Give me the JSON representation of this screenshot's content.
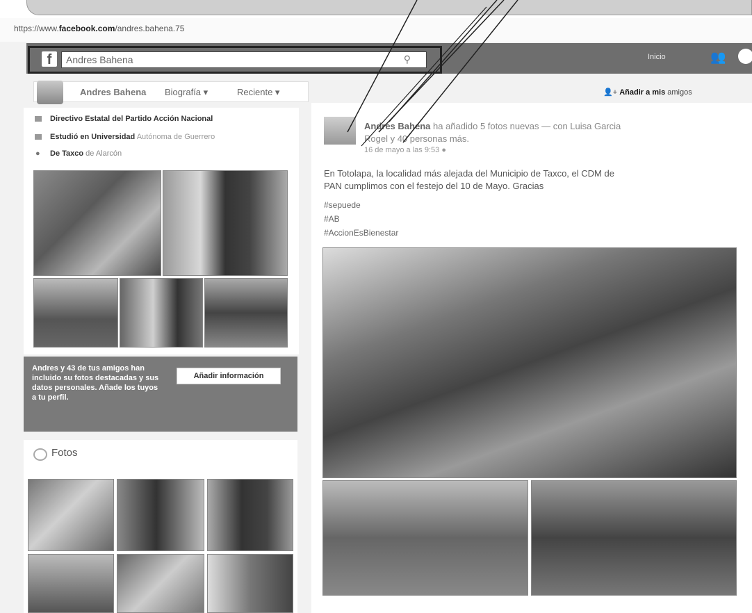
{
  "browser": {
    "url_prefix": "https://www.",
    "url_domain": "facebook.com",
    "url_path": "/andres.bahena.75"
  },
  "fb_bar": {
    "logo": "f",
    "search_value": "Andres Bahena",
    "inicio": "Inicio"
  },
  "profile_nav": {
    "name": "Andres Bahena",
    "biografia": "Biografía",
    "reciente": "Reciente"
  },
  "add_friends": {
    "bold": "Añadir a mis",
    "rest": "amigos"
  },
  "left_info": {
    "line1": "Directivo Estatal del Partido Acción Nacional",
    "line2_bold": "Estudió en Universidad",
    "line2_rest": "Autónoma de Guerrero",
    "line3_bold": "De Taxco",
    "line3_rest": "de Alarcón"
  },
  "promo": {
    "text": "Andres y 43 de tus amigos han incluido su fotos destacadas y sus datos personales. Añade los tuyos a tu perfil.",
    "button": "Añadir información"
  },
  "photos_section": {
    "title": "Fotos"
  },
  "post": {
    "author": "Andres Bahena",
    "action": "ha añadido 5 fotos nuevas — con Luisa Garcia",
    "tagged": "Rogel y 40 personas más.",
    "date": "16 de mayo a las 9:53",
    "body_line1": "En Totolapa, la localidad más alejada del Municipio de Taxco, el CDM de",
    "body_line2": "PAN cumplimos con el festejo del 10 de Mayo. Gracias",
    "hashtags": [
      "#sepuede",
      "#AB",
      "#AccionEsBienestar"
    ]
  }
}
